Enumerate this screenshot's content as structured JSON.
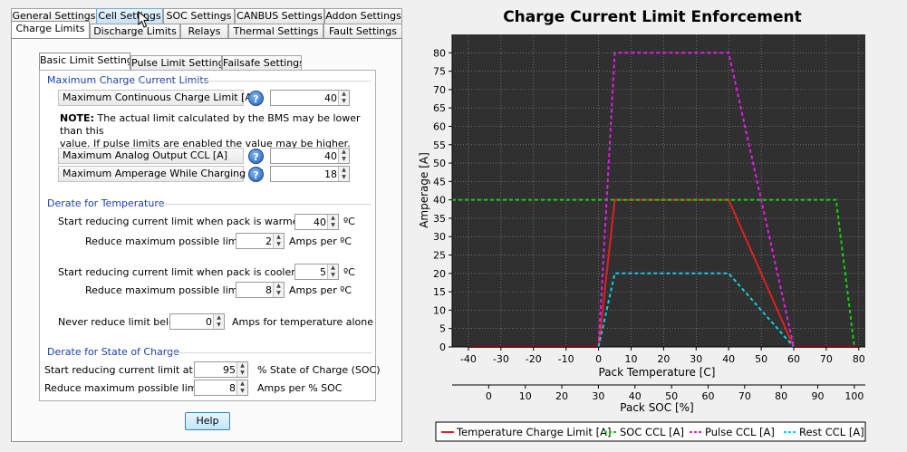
{
  "tabs_row1": [
    "General Settings",
    "Cell Settings",
    "SOC Settings",
    "CANBUS Settings",
    "Addon Settings"
  ],
  "tabs_row2": [
    "Charge Limits",
    "Discharge Limits",
    "Relays",
    "Thermal Settings",
    "Fault Settings"
  ],
  "subtabs": [
    "Basic Limit Settings",
    "Pulse Limit Settings",
    "Failsafe Settings"
  ],
  "max_charge": {
    "title": "Maximum Charge Current Limits",
    "cont_label": "Maximum Continuous Charge Limit [A]",
    "cont_value": "40",
    "note_bold": "NOTE:",
    "note_line1": "The actual limit calculated by the BMS may be lower than this",
    "note_line2": "value. If pulse limits are enabled the value may be higher.",
    "analog_label": "Maximum Analog Output CCL [A]",
    "analog_value": "40",
    "amp_label": "Maximum Amperage While Charging [A]",
    "amp_value": "18"
  },
  "derate_temp": {
    "title": "Derate for Temperature",
    "warm_label": "Start reducing current limit when pack is warmer than",
    "warm_value": "40",
    "warm_unit": "ºC",
    "warm_reduce_label": "Reduce maximum possible limit by",
    "warm_reduce_value": "2",
    "warm_reduce_unit": "Amps per ºC",
    "cool_label": "Start reducing current limit when pack is cooler than",
    "cool_value": "5",
    "cool_unit": "ºC",
    "cool_reduce_label": "Reduce maximum possible limit by",
    "cool_reduce_value": "8",
    "cool_reduce_unit": "Amps per ºC",
    "never_label": "Never reduce limit below",
    "never_value": "0",
    "never_unit": "Amps for temperature alone"
  },
  "derate_soc": {
    "title": "Derate for State of Charge",
    "start_label": "Start reducing current limit at",
    "start_value": "95",
    "start_unit": "% State of Charge (SOC)",
    "reduce_label": "Reduce maximum possible limit by",
    "reduce_value": "8",
    "reduce_unit": "Amps per % SOC"
  },
  "help_button": "Help",
  "help_glyph": "?",
  "chart_data": {
    "type": "line",
    "title": "Charge Current Limit Enforcement",
    "xlabel": "Pack Temperature [C]",
    "x2label": "Pack SOC [%]",
    "ylabel": "Amperage [A]",
    "xlim": [
      -45,
      82
    ],
    "x_ticks": [
      -40,
      -30,
      -20,
      -10,
      0,
      10,
      20,
      30,
      40,
      50,
      60,
      70,
      80
    ],
    "x2lim": [
      -10,
      103
    ],
    "x2_ticks": [
      0,
      10,
      20,
      30,
      40,
      50,
      60,
      70,
      80,
      90,
      100
    ],
    "ylim": [
      0,
      85
    ],
    "y_ticks": [
      0,
      5,
      10,
      15,
      20,
      25,
      30,
      35,
      40,
      45,
      50,
      55,
      60,
      65,
      70,
      75,
      80
    ],
    "grid": true,
    "legend_position": "bottom",
    "background": "#303030",
    "series": [
      {
        "name": "Temperature Charge Limit [A]",
        "color": "#e02020",
        "dash": false,
        "axis": "temp",
        "x": [
          -40,
          -1,
          0,
          5,
          40,
          60,
          80
        ],
        "y": [
          0,
          0,
          0,
          40,
          40,
          0,
          0
        ]
      },
      {
        "name": "SOC CCL [A]",
        "color": "#10d010",
        "dash": true,
        "axis": "soc",
        "x": [
          -10,
          95,
          100
        ],
        "y": [
          40,
          40,
          0
        ]
      },
      {
        "name": "Pulse CCL [A]",
        "color": "#e020e0",
        "dash": true,
        "axis": "temp",
        "x": [
          0,
          5,
          40,
          60
        ],
        "y": [
          0,
          80,
          80,
          0
        ]
      },
      {
        "name": "Rest CCL [A]",
        "color": "#10d0e0",
        "dash": true,
        "axis": "temp",
        "x": [
          0,
          5,
          40,
          60
        ],
        "y": [
          0,
          20,
          20,
          0
        ]
      }
    ]
  }
}
